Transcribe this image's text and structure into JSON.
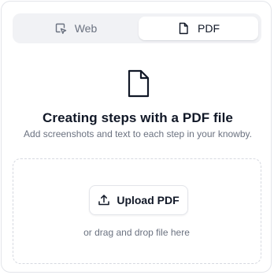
{
  "tabs": [
    {
      "label": "Web",
      "icon": "cursor-click-icon",
      "active": false
    },
    {
      "label": "PDF",
      "icon": "file-icon",
      "active": true
    }
  ],
  "hero_icon": "file-icon",
  "title": "Creating steps with a PDF file",
  "subtitle": "Add screenshots and text to each step in your knowby.",
  "dropzone": {
    "button_label": "Upload PDF",
    "button_icon": "upload-icon",
    "hint": "or drag and drop file here"
  },
  "colors": {
    "text": "#111827",
    "muted": "#6b7280",
    "border": "#e3e5ea",
    "segment_bg": "#f1f2f5"
  }
}
